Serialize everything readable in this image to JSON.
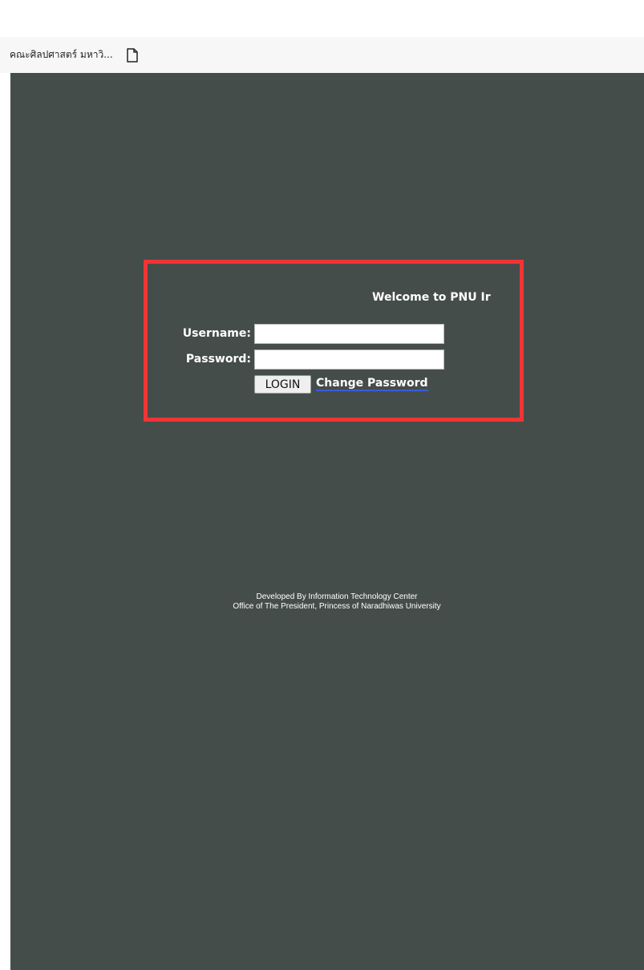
{
  "bookmarks_bar": {
    "items": [
      {
        "label": "คณะศิลปศาสตร์ มหาวิ...",
        "icon": "bookmark-favicon"
      }
    ],
    "extra_icon": "file-icon"
  },
  "login": {
    "welcome_text": "Welcome to PNU Ir",
    "username_label": "Username:",
    "username_value": "",
    "password_label": "Password:",
    "password_value": "",
    "login_button": "LOGIN",
    "change_password_link": "Change Password"
  },
  "footer": {
    "line1": "Developed By Information Technology Center",
    "line2": "Office of The President, Princess of Naradhiwas University"
  },
  "colors": {
    "page_background": "#454d4b",
    "highlight_border": "#f13434",
    "link_underline": "#3b5bd9"
  }
}
